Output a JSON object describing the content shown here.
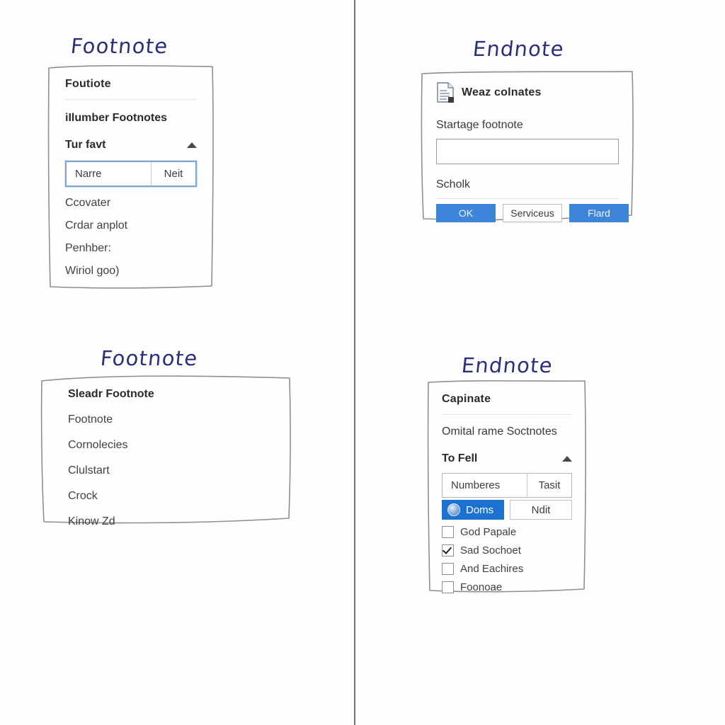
{
  "canvas": {
    "background": "#fdfdfd",
    "divider_color": "#3a3a3a",
    "caption_color": "#2c2f7a",
    "accent_primary": "#3d85d8",
    "accent_selection": "#1b72d0"
  },
  "quadrants": [
    {
      "caption": "Footnote",
      "panel": {
        "header": "Foutiote",
        "subtitle": "iIlumber Footnotes",
        "section_label": "Tur favt",
        "collapse_icon": "chevron-up-icon",
        "combo": {
          "value": "Narre",
          "side": "Neit"
        },
        "options": [
          "Ccovater",
          "Crdar anplot",
          "Penhber:",
          "Wiriol goo)"
        ]
      }
    },
    {
      "caption": "Endnote",
      "panel": {
        "icon": "document-icon",
        "header": "Weaz colnates",
        "field_label": "Startage footnote",
        "field_value": "",
        "field_placeholder": "",
        "footer_label": "Scholk",
        "buttons": [
          {
            "label": "OK",
            "style": "primary"
          },
          {
            "label": "Serviceus",
            "style": "secondary"
          },
          {
            "label": "Flard",
            "style": "primary"
          }
        ]
      }
    },
    {
      "caption": "Footnote",
      "panel": {
        "header": "Sleadr Footnote",
        "items": [
          "Footnote",
          "Cornolecies",
          "Clulstart",
          "Crock",
          "Kinow Zd"
        ]
      }
    },
    {
      "caption": "Endnote",
      "panel": {
        "header": "Capinate",
        "subtitle": "Omital rame Soctnotes",
        "section_label": "To Fell",
        "collapse_icon": "chevron-up-icon",
        "combo": {
          "value": "Numberes",
          "side": "Tasit"
        },
        "selected_row": {
          "icon": "globe-icon",
          "label": "Doms",
          "side": "Ndit"
        },
        "checkboxes": [
          {
            "label": "God Papale",
            "checked": false
          },
          {
            "label": "Sad Sochoet",
            "checked": true
          },
          {
            "label": "And Eachires",
            "checked": false
          },
          {
            "label": "Foonoae",
            "checked": false
          }
        ]
      }
    }
  ]
}
